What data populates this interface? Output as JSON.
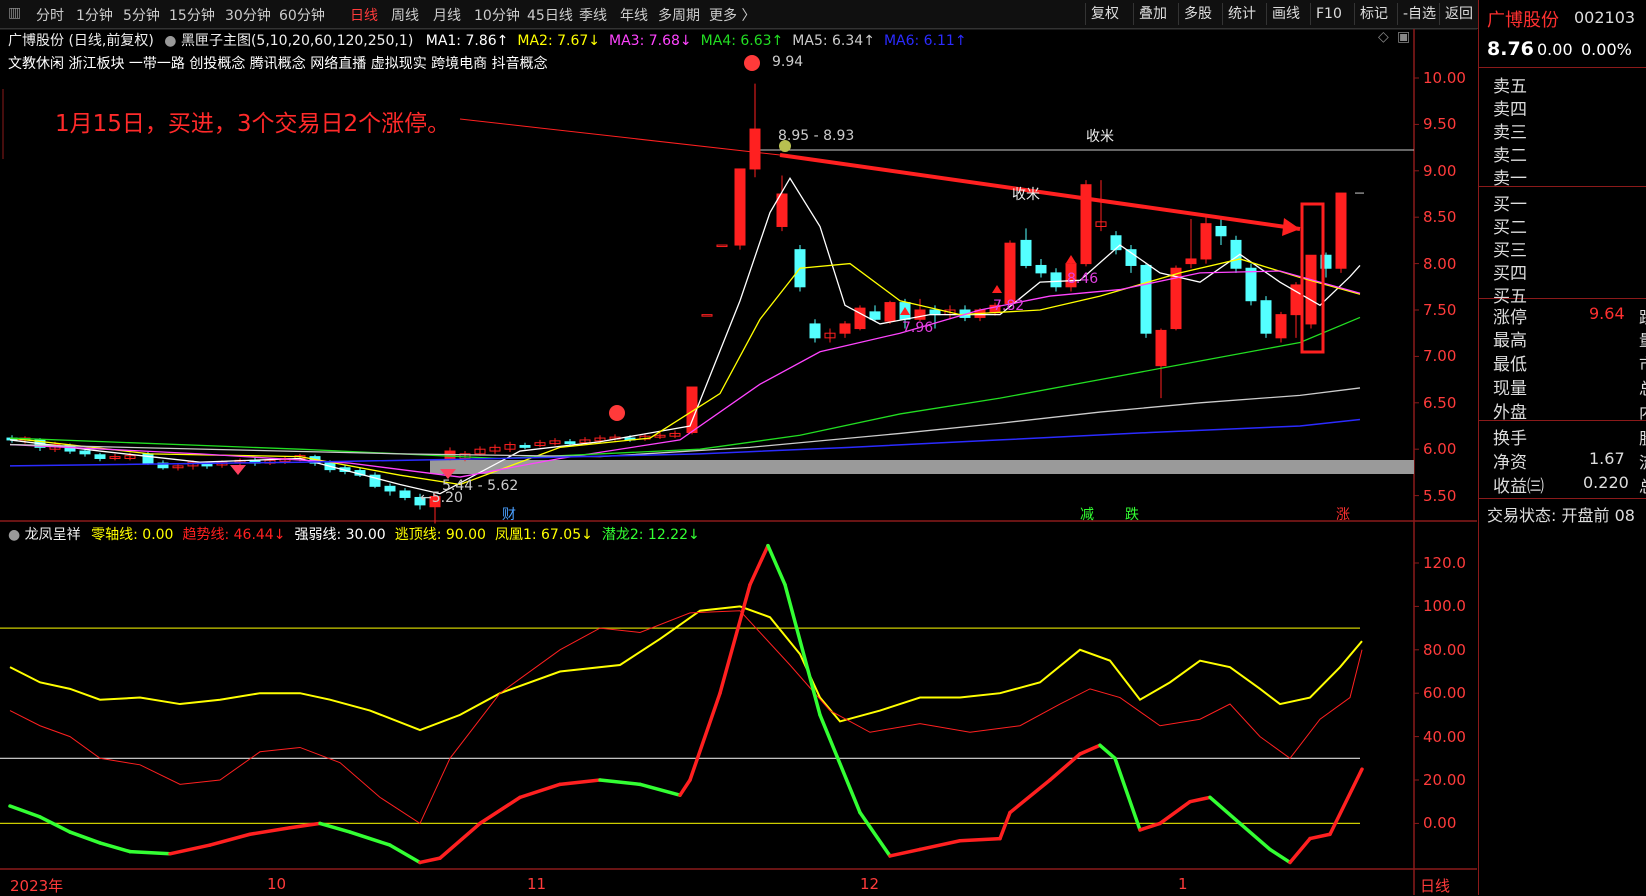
{
  "toolbar": {
    "periods": [
      "分时",
      "1分钟",
      "5分钟",
      "15分钟",
      "30分钟",
      "60分钟",
      "日线",
      "周线",
      "月线",
      "10分钟",
      "45日线",
      "季线",
      "年线",
      "多周期",
      "更多 〉"
    ],
    "active_period": "日线",
    "right_buttons": [
      "复权",
      "叠加",
      "多股",
      "统计",
      "画线",
      "F10",
      "标记",
      "-自选",
      "返回"
    ]
  },
  "stock_header": {
    "title": "广博股份 (日线,前复权)",
    "indicator_name": "黑匣子主图(5,10,20,60,120,250,1)",
    "ma": [
      {
        "label": "MA1: 7.86↑",
        "color": "#ffffff"
      },
      {
        "label": "MA2: 7.67↓",
        "color": "#ffff00"
      },
      {
        "label": "MA3: 7.68↓",
        "color": "#ff44ff"
      },
      {
        "label": "MA4: 6.63↑",
        "color": "#22dd22"
      },
      {
        "label": "MA5: 6.34↑",
        "color": "#cccccc"
      },
      {
        "label": "MA6: 6.11↑",
        "color": "#2b2bff"
      }
    ],
    "concepts": "文教休闲 浙江板块 一带一路 创投概念 腾讯概念 网络直播 虚拟现实 跨境电商 抖音概念"
  },
  "annotation_text": "1月15日，买进，3个交易日2个涨停。",
  "price_labels": {
    "high": "9.94",
    "range1": "8.95 - 8.93",
    "range2": "5.44 - 5.62",
    "low": "←5.20",
    "shoumi1": "收米",
    "shoumi2": "收米",
    "p796": "7.96",
    "p782": "7.82",
    "p846": "8.46"
  },
  "event_marks": {
    "cai": "财",
    "jian": "减",
    "die": "跌",
    "zhang": "涨"
  },
  "y_axis_main": [
    "10.00",
    "9.50",
    "9.00",
    "8.50",
    "8.00",
    "7.50",
    "7.00",
    "6.50",
    "6.00",
    "5.50"
  ],
  "indicator_header": {
    "name": "龙凤呈祥",
    "items": [
      {
        "label": "零轴线: 0.00",
        "color": "#ffff00"
      },
      {
        "label": "趋势线: 46.44↓",
        "color": "#ff2020"
      },
      {
        "label": "强弱线: 30.00",
        "color": "#ffffff"
      },
      {
        "label": "逃顶线: 90.00",
        "color": "#ffff00"
      },
      {
        "label": "凤凰1: 67.05↓",
        "color": "#ffff00"
      },
      {
        "label": "潜龙2: 12.22↓",
        "color": "#33ff33"
      }
    ]
  },
  "y_axis_ind": [
    "120.0",
    "100.0",
    "80.00",
    "60.00",
    "40.00",
    "20.00",
    "0.00"
  ],
  "x_axis": [
    "2023年",
    "10",
    "11",
    "12",
    "1",
    "日线"
  ],
  "side_panel": {
    "name": "广博股份",
    "code": "002103",
    "price": "8.76",
    "change": "0.00",
    "pct": "0.00%",
    "sell": [
      "卖五",
      "卖四",
      "卖三",
      "卖二",
      "卖一"
    ],
    "buy": [
      "买一",
      "买二",
      "买三",
      "买四",
      "买五"
    ],
    "limit_up_label": "涨停",
    "limit_up_value": "9.64",
    "limit_up_right": "跌",
    "rows": [
      {
        "label": "最高",
        "right": "量"
      },
      {
        "label": "最低",
        "right": "市"
      },
      {
        "label": "现量",
        "right": "总"
      },
      {
        "label": "外盘",
        "right": "内"
      }
    ],
    "turnover_label": "换手",
    "turnover_right": "股",
    "nav_label": "净资",
    "nav_value": "1.67",
    "nav_right": "流",
    "eps_label": "收益㈢",
    "eps_value": "0.220",
    "eps_right": "总",
    "status": "交易状态: 开盘前 08"
  },
  "colors": {
    "up": "#ff2020",
    "down": "#54ffff",
    "axis": "#8b1a1a",
    "ma1": "#ffffff",
    "ma2": "#ffff00",
    "ma3": "#ff44ff",
    "ma4": "#22dd22",
    "ma5": "#cccccc",
    "ma6": "#2b2bff"
  }
}
